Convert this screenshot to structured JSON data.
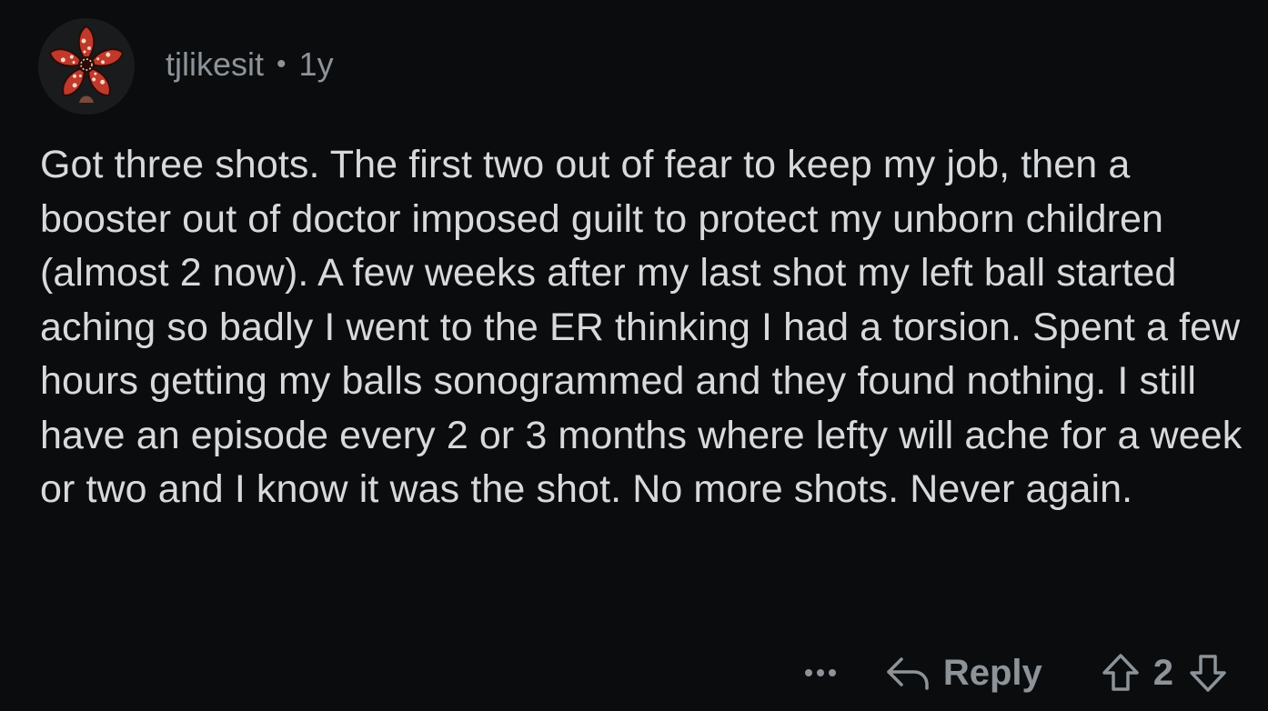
{
  "comment": {
    "author": "tjlikesit",
    "separator": "•",
    "age": "1y",
    "body": "Got three shots. The first two out of fear to keep my job, then a booster out of doctor imposed guilt to protect my unborn children (almost 2 now). A few weeks after my last shot my left ball started aching so badly I went to the ER thinking I had a torsion. Spent a few hours getting my balls sonogrammed and they found nothing. I still have an episode every 2 or 3 months where lefty will ache for a week or two and I know it was the shot. No more shots. Never again.",
    "score": "2"
  },
  "actions": {
    "reply_label": "Reply",
    "more_icon": "ellipsis-icon",
    "reply_icon": "reply-arrow-icon",
    "upvote_icon": "upvote-arrow-icon",
    "downvote_icon": "downvote-arrow-icon"
  },
  "colors": {
    "background": "#0b0c0e",
    "text": "#d7dadc",
    "muted": "#8c9399",
    "avatar_flower": "#c0392b",
    "avatar_spots": "#f4d7c4"
  }
}
